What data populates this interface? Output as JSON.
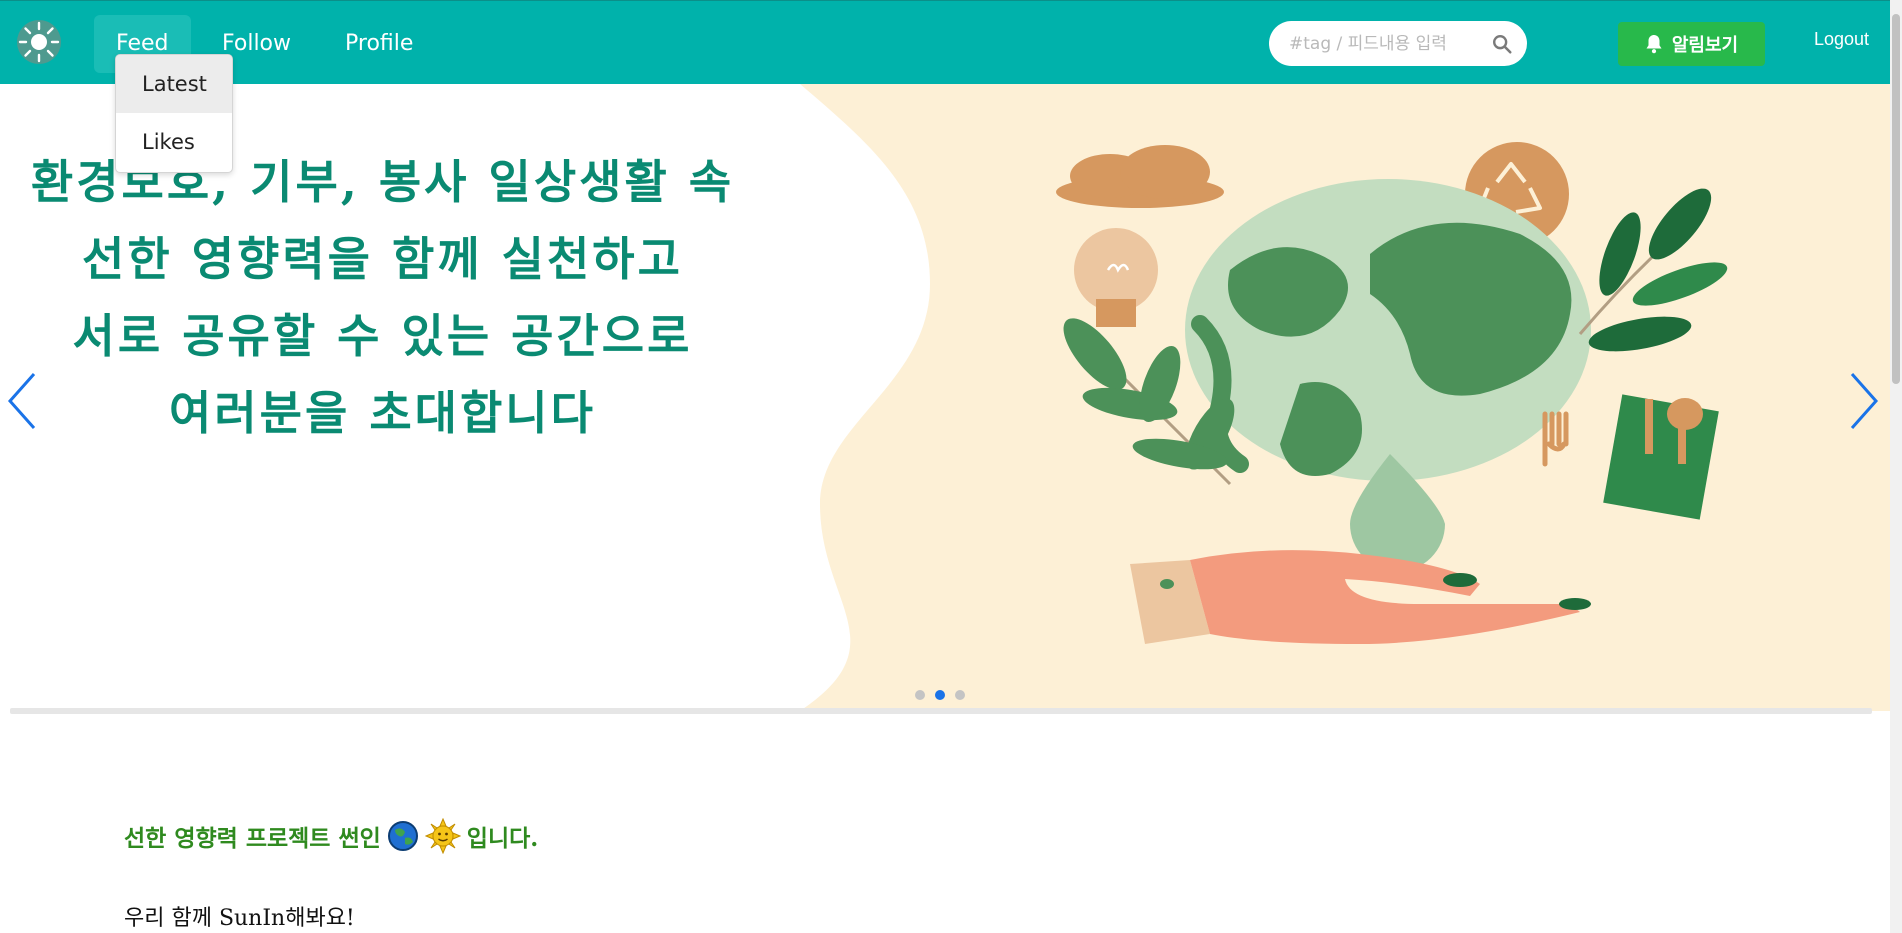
{
  "nav": {
    "items": [
      {
        "label": "Feed"
      },
      {
        "label": "Follow"
      },
      {
        "label": "Profile"
      }
    ],
    "active": "Feed",
    "search_placeholder": "#tag / 피드내용 입력",
    "notification_label": "알림보기",
    "logout_label": "Logout"
  },
  "dropdown": {
    "items": [
      {
        "label": "Latest"
      },
      {
        "label": "Likes"
      }
    ],
    "hovered": "Latest"
  },
  "hero": {
    "lines": [
      "환경보호, 기부, 봉사 일상생활 속",
      "선한 영향력을 함께 실천하고",
      "서로 공유할 수 있는 공간으로",
      "여러분을 초대합니다"
    ],
    "dots_count": 3,
    "active_dot": 2
  },
  "content": {
    "intro_prefix": "선한 영향력 프로젝트 썬인",
    "intro_suffix": "입니다.",
    "together": "우리 함께 SunIn해봐요!"
  },
  "colors": {
    "header": "#00b2ab",
    "notify_button": "#28b94b",
    "hero_text": "#0a8a72",
    "hero_bg": "#fdf0d6",
    "active_dot": "#1a73e8"
  },
  "icons": {
    "logo": "sun-logo-icon",
    "search": "search-icon",
    "bell": "bell-icon",
    "prev": "chevron-left-icon",
    "next": "chevron-right-icon"
  }
}
